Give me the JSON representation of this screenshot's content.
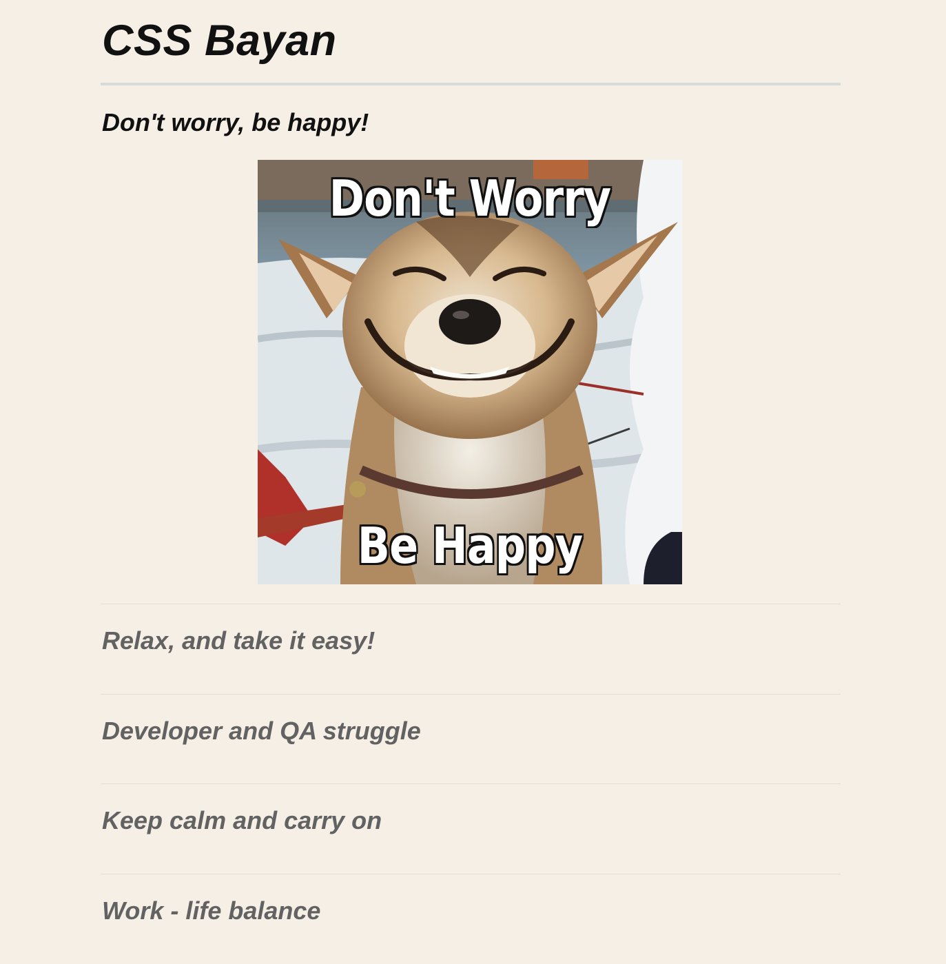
{
  "site": {
    "title": "CSS Bayan"
  },
  "accordion": {
    "items": [
      {
        "title": "Don't worry, be happy!",
        "expanded": true,
        "image": {
          "description_icon": "smiling-dog-meme",
          "top_caption": "Don't Worry",
          "bottom_caption": "Be Happy"
        }
      },
      {
        "title": "Relax, and take it easy!",
        "expanded": false
      },
      {
        "title": "Developer and QA struggle",
        "expanded": false
      },
      {
        "title": "Keep calm and carry on",
        "expanded": false
      },
      {
        "title": "Work - life balance",
        "expanded": false
      }
    ]
  },
  "colors": {
    "background": "#f5efe6",
    "active_title": "#111111",
    "collapsed_title": "#626262",
    "divider": "#d6dad8"
  }
}
